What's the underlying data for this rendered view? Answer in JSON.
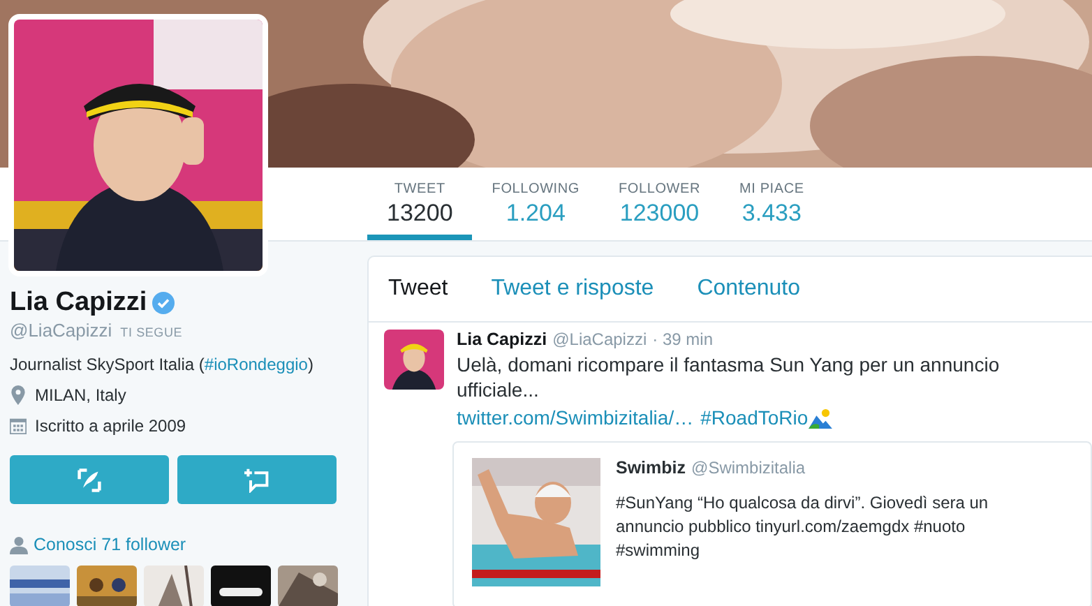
{
  "stats": [
    {
      "label": "TWEET",
      "value": "13200",
      "selected": true
    },
    {
      "label": "FOLLOWING",
      "value": "1.204",
      "selected": false
    },
    {
      "label": "FOLLOWER",
      "value": "123000",
      "selected": false
    },
    {
      "label": "MI PIACE",
      "value": "3.433",
      "selected": false
    }
  ],
  "profile": {
    "name": "Lia Capizzi",
    "verified": true,
    "handle": "@LiaCapizzi",
    "follows_you": "TI SEGUE",
    "bio": {
      "text": "Journalist SkySport Italia (",
      "link": "#ioRondeggio",
      "after": ")"
    },
    "location": "MILAN, Italy",
    "joined": "Iscritto a aprile 2009"
  },
  "followers_known": {
    "label": "Conosci 71 follower"
  },
  "tabs": [
    {
      "label": "Tweet",
      "selected": true
    },
    {
      "label": "Tweet e risposte",
      "selected": false
    },
    {
      "label": "Contenuto",
      "selected": false
    }
  ],
  "tweet": {
    "name": "Lia Capizzi",
    "handle": "@LiaCapizzi",
    "time": "· 39 min",
    "text": "Uelà, domani ricompare il fantasma Sun Yang per un annuncio ufficiale...",
    "links": [
      "twitter.com/Swimbizitalia/…",
      "#RoadToRio"
    ],
    "quote": {
      "name": "Swimbiz",
      "handle": "@Swimbizitalia",
      "text": "#SunYang “Ho qualcosa da dirvi”. Giovedì sera un annuncio pubblico tinyurl.com/zaemgdx #nuoto #swimming"
    }
  }
}
